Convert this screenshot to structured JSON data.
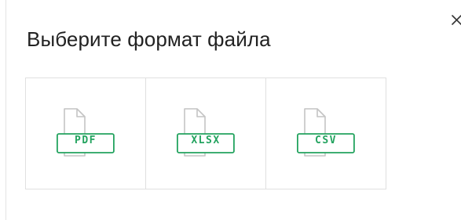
{
  "dialog": {
    "title": "Выберите формат файла",
    "close_icon": "close-icon",
    "close_glyph": "×"
  },
  "formats": [
    {
      "label": "PDF",
      "icon": "file-icon"
    },
    {
      "label": "XLSX",
      "icon": "file-icon"
    },
    {
      "label": "CSV",
      "icon": "file-icon"
    }
  ],
  "colors": {
    "accent": "#23a35f",
    "icon_outline": "#c4c4c4",
    "border": "#e0e0e0",
    "title_text": "#222222"
  }
}
